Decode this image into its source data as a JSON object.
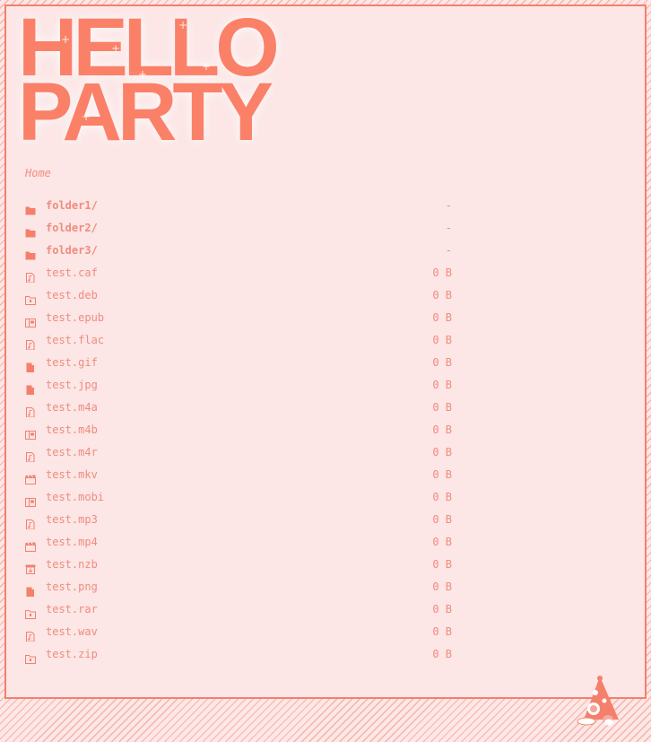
{
  "header": {
    "title_line1": "HELLO",
    "title_line2": "PARTY"
  },
  "breadcrumb": {
    "label": "Home"
  },
  "files": [
    {
      "name": "folder1/",
      "size": "-",
      "type": "folder",
      "icon": "folder-icon"
    },
    {
      "name": "folder2/",
      "size": "-",
      "type": "folder",
      "icon": "folder-icon"
    },
    {
      "name": "folder3/",
      "size": "-",
      "type": "folder",
      "icon": "folder-icon"
    },
    {
      "name": "test.caf",
      "size": "0 B",
      "type": "file",
      "icon": "audio-file-icon"
    },
    {
      "name": "test.deb",
      "size": "0 B",
      "type": "file",
      "icon": "archive-icon"
    },
    {
      "name": "test.epub",
      "size": "0 B",
      "type": "file",
      "icon": "book-icon"
    },
    {
      "name": "test.flac",
      "size": "0 B",
      "type": "file",
      "icon": "audio-file-icon"
    },
    {
      "name": "test.gif",
      "size": "0 B",
      "type": "file",
      "icon": "image-file-icon"
    },
    {
      "name": "test.jpg",
      "size": "0 B",
      "type": "file",
      "icon": "image-file-icon"
    },
    {
      "name": "test.m4a",
      "size": "0 B",
      "type": "file",
      "icon": "audio-file-icon"
    },
    {
      "name": "test.m4b",
      "size": "0 B",
      "type": "file",
      "icon": "book-icon"
    },
    {
      "name": "test.m4r",
      "size": "0 B",
      "type": "file",
      "icon": "audio-file-icon"
    },
    {
      "name": "test.mkv",
      "size": "0 B",
      "type": "file",
      "icon": "video-icon"
    },
    {
      "name": "test.mobi",
      "size": "0 B",
      "type": "file",
      "icon": "book-icon"
    },
    {
      "name": "test.mp3",
      "size": "0 B",
      "type": "file",
      "icon": "audio-file-icon"
    },
    {
      "name": "test.mp4",
      "size": "0 B",
      "type": "file",
      "icon": "video-icon"
    },
    {
      "name": "test.nzb",
      "size": "0 B",
      "type": "file",
      "icon": "download-file-icon"
    },
    {
      "name": "test.png",
      "size": "0 B",
      "type": "file",
      "icon": "image-file-icon"
    },
    {
      "name": "test.rar",
      "size": "0 B",
      "type": "file",
      "icon": "archive-icon"
    },
    {
      "name": "test.wav",
      "size": "0 B",
      "type": "file",
      "icon": "audio-file-icon"
    },
    {
      "name": "test.zip",
      "size": "0 B",
      "type": "file",
      "icon": "archive-icon"
    }
  ],
  "colors": {
    "accent": "#fb8068",
    "text": "#f08c7d",
    "background": "#fce6e6",
    "stripe": "#f6b3aa"
  },
  "decor": {
    "party_hat": "party-hat-icon"
  }
}
